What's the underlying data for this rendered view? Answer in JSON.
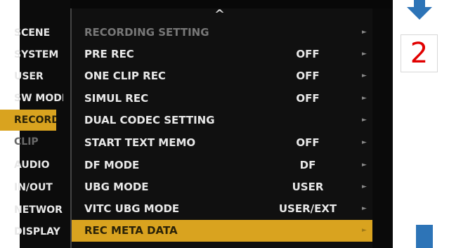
{
  "left_menu": [
    {
      "label": "SCENE",
      "state": "normal"
    },
    {
      "label": "SYSTEM",
      "state": "normal"
    },
    {
      "label": "USER",
      "state": "normal"
    },
    {
      "label": "SW MODE",
      "state": "normal"
    },
    {
      "label": "RECORDING",
      "state": "selected"
    },
    {
      "label": "CLIP",
      "state": "disabled"
    },
    {
      "label": "AUDIO",
      "state": "normal"
    },
    {
      "label": "IN/OUT",
      "state": "normal"
    },
    {
      "label": "NETWORK",
      "state": "normal"
    },
    {
      "label": "DISPLAY",
      "state": "normal"
    }
  ],
  "submenu": {
    "scroll_up": "^",
    "rows": [
      {
        "label": "RECORDING SETTING",
        "value": "",
        "arrow": "►",
        "dim": true
      },
      {
        "label": "PRE REC",
        "value": "OFF",
        "arrow": "►"
      },
      {
        "label": "ONE CLIP REC",
        "value": "OFF",
        "arrow": "►"
      },
      {
        "label": "SIMUL REC",
        "value": "OFF",
        "arrow": "►"
      },
      {
        "label": "DUAL CODEC SETTING",
        "value": "",
        "arrow": "►"
      },
      {
        "label": "START TEXT MEMO",
        "value": "OFF",
        "arrow": "►"
      },
      {
        "label": "DF MODE",
        "value": "DF",
        "arrow": "►"
      },
      {
        "label": "UBG MODE",
        "value": "USER",
        "arrow": "►"
      },
      {
        "label": "VITC UBG MODE",
        "value": "USER/EXT",
        "arrow": "►"
      },
      {
        "label": "REC META DATA",
        "value": "",
        "arrow": "►",
        "selected": true
      }
    ]
  },
  "annotation": {
    "step_number": "2",
    "colors": {
      "step_number": "#e10000",
      "arrow": "#2d74b7",
      "highlight": "#d9a31f"
    }
  }
}
